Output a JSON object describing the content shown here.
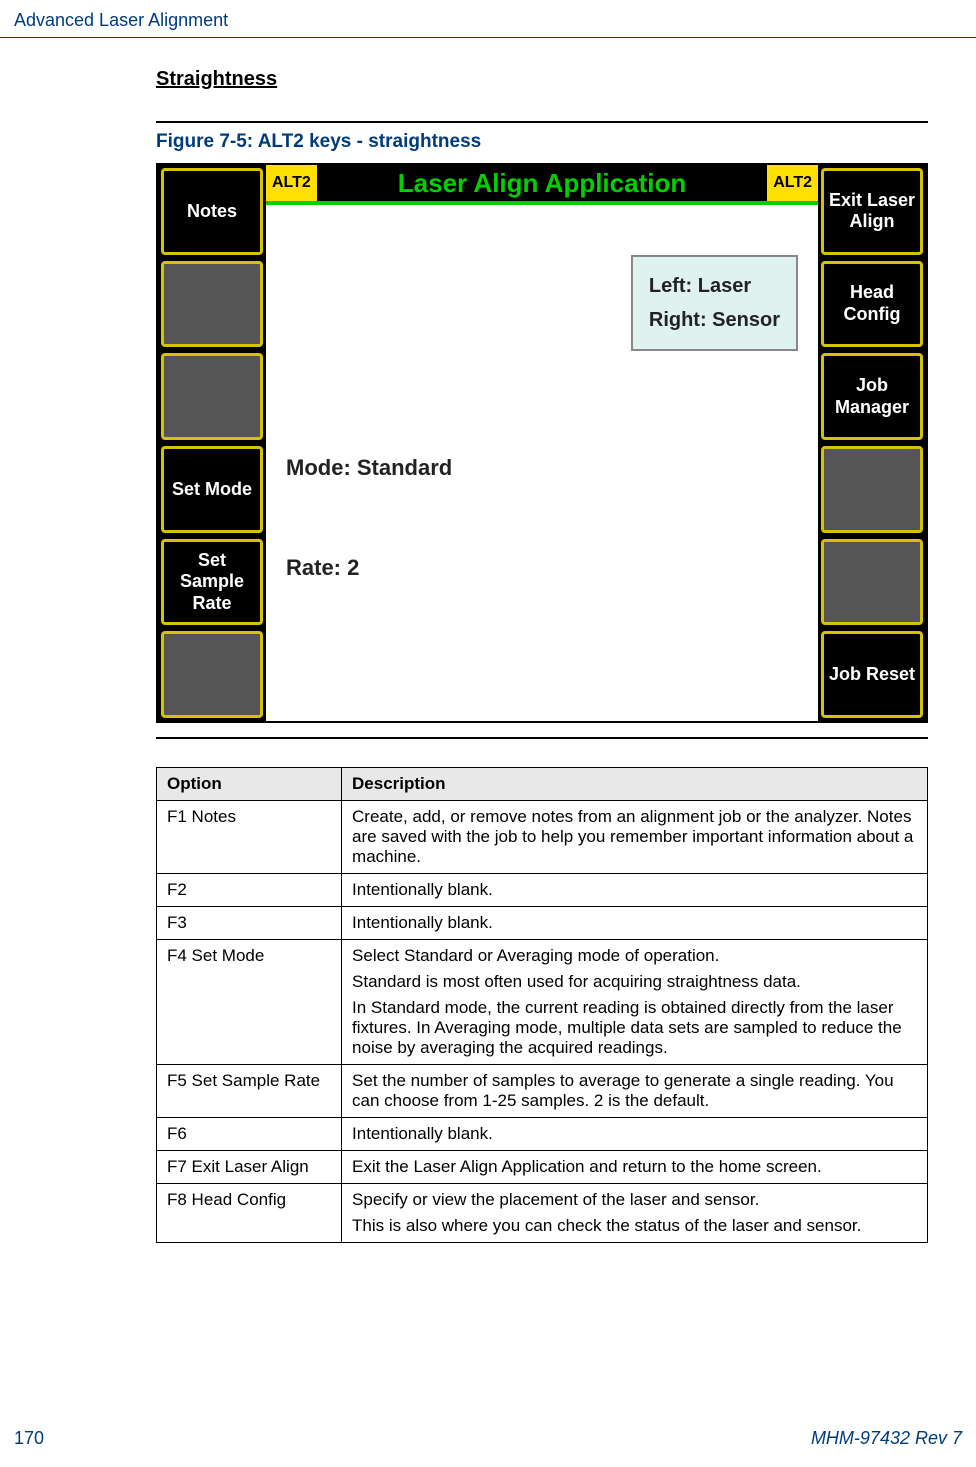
{
  "header": {
    "title": "Advanced Laser Alignment"
  },
  "section": {
    "subheading": "Straightness"
  },
  "figure": {
    "caption": "Figure 7-5:   ALT2 keys - straightness",
    "title": "Laser Align Application",
    "alt_badge": "ALT2",
    "left_keys": [
      "Notes",
      "",
      "",
      "Set Mode",
      "Set Sample Rate",
      ""
    ],
    "right_keys": [
      "Exit Laser Align",
      "Head Config",
      "Job Manager",
      "",
      "",
      "Job Reset"
    ],
    "info_left": "Left:  Laser",
    "info_right": "Right:  Sensor",
    "mode_line": "Mode: Standard",
    "rate_line": "Rate:   2"
  },
  "table": {
    "headers": [
      "Option",
      "Description"
    ],
    "rows": [
      {
        "option": "F1 Notes",
        "desc": [
          "Create, add, or remove notes from an alignment job or the analyzer. Notes are saved with the job to help you remember important information about a machine."
        ]
      },
      {
        "option": "F2",
        "desc": [
          "Intentionally blank."
        ]
      },
      {
        "option": "F3",
        "desc": [
          "Intentionally blank."
        ]
      },
      {
        "option": "F4 Set Mode",
        "desc": [
          "Select Standard or Averaging mode of operation.",
          "Standard is most often used for acquiring straightness data.",
          "In Standard mode, the current reading is obtained directly from the laser fixtures. In Averaging mode, multiple data sets are sampled to reduce the noise by averaging the acquired readings."
        ]
      },
      {
        "option": "F5 Set Sample Rate",
        "desc": [
          "Set the number of samples to average to generate a single reading. You can choose from 1-25 samples. 2 is the default."
        ]
      },
      {
        "option": "F6",
        "desc": [
          "Intentionally blank."
        ]
      },
      {
        "option": "F7 Exit Laser Align",
        "desc": [
          "Exit the Laser Align Application and return to the home screen."
        ]
      },
      {
        "option": "F8 Head Config",
        "desc": [
          "Specify or view the placement of the laser and sensor.",
          "This is also where you can check the status of the laser and sensor."
        ]
      }
    ]
  },
  "footer": {
    "page": "170",
    "doc": "MHM-97432 Rev 7"
  }
}
